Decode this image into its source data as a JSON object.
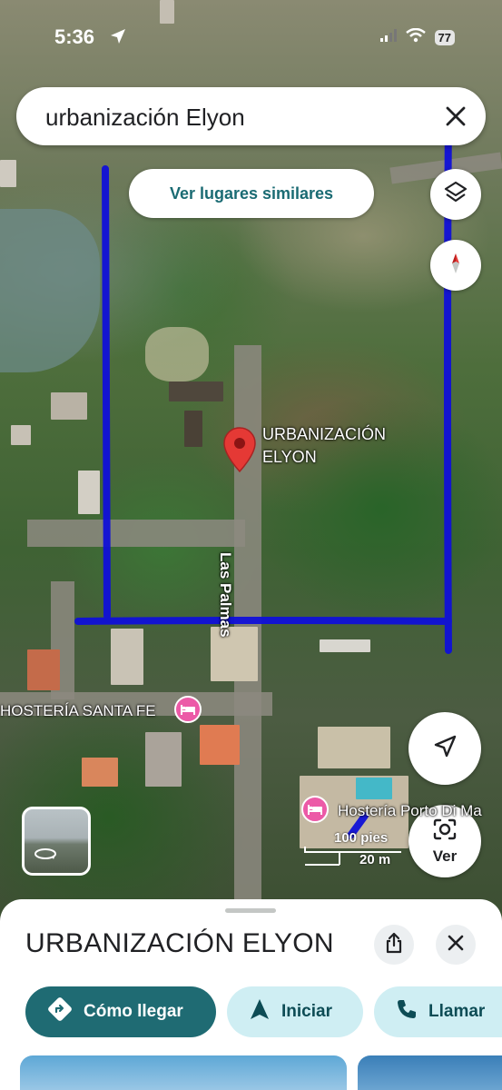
{
  "status_bar": {
    "time": "5:36",
    "battery": "77"
  },
  "search": {
    "query": "urbanización Elyon"
  },
  "chip": {
    "label": "Ver lugares similares"
  },
  "map": {
    "pin_label_line1": "URBANIZACIÓN",
    "pin_label_line2": "ELYON",
    "street": "Las Palmas",
    "poi_santa_fe": "HOSTERÍA SANTA FE",
    "poi_porto": "Hostería Porto Di Ma",
    "scale_imperial": "100 pies",
    "scale_metric": "20 m",
    "lens_label": "Ver"
  },
  "sheet": {
    "title": "URBANIZACIÓN ELYON",
    "actions": {
      "directions": "Cómo llegar",
      "start": "Iniciar",
      "call": "Llamar"
    }
  },
  "colors": {
    "accent": "#1f6b73",
    "secondary_bg": "#cfeef3",
    "annotation": "#1010d8",
    "pin": "#e53935",
    "poi": "#ec5aa7"
  },
  "icons": [
    "location-arrow-icon",
    "signal-icon",
    "wifi-icon",
    "battery-icon",
    "close-icon",
    "layers-icon",
    "compass-icon",
    "my-location-icon",
    "lens-icon",
    "share-icon",
    "directions-icon",
    "navigate-icon",
    "phone-icon",
    "hotel-icon",
    "360-icon"
  ]
}
